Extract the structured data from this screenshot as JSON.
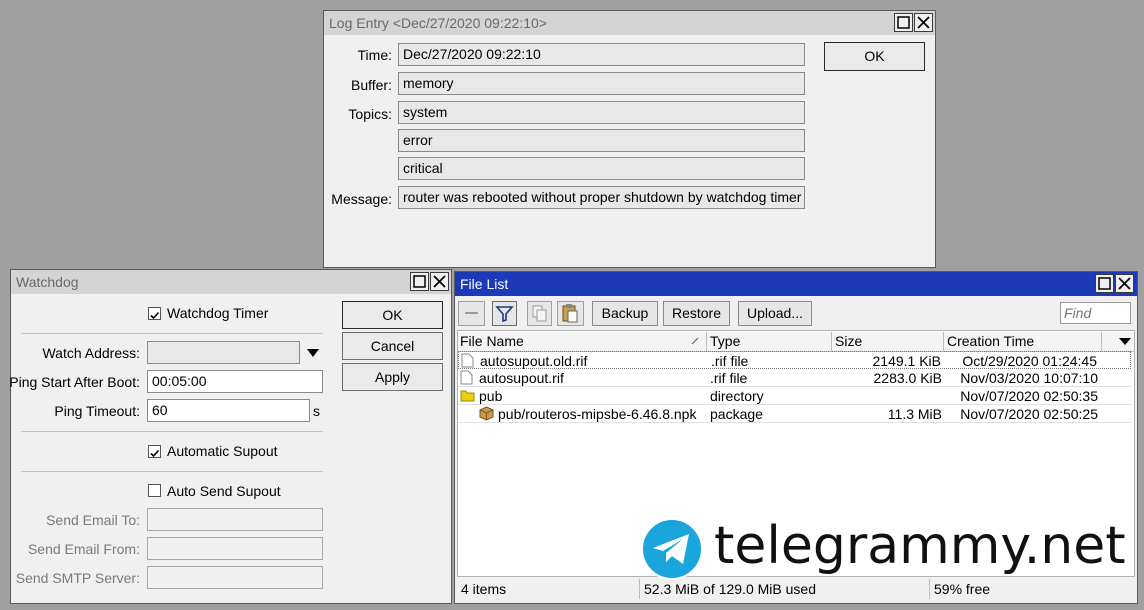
{
  "log_entry": {
    "title": "Log Entry <Dec/27/2020 09:22:10>",
    "labels": {
      "time": "Time:",
      "buffer": "Buffer:",
      "topics": "Topics:",
      "message": "Message:"
    },
    "time": "Dec/27/2020 09:22:10",
    "buffer": "memory",
    "topics": [
      "system",
      "error",
      "critical"
    ],
    "message": "router was rebooted without proper shutdown by watchdog timer",
    "ok_label": "OK"
  },
  "watchdog": {
    "title": "Watchdog",
    "watchdog_timer": {
      "label": "Watchdog Timer",
      "checked": true
    },
    "watch_address": {
      "label": "Watch Address:",
      "value": ""
    },
    "ping_start": {
      "label": "Ping Start After Boot:",
      "value": "00:05:00"
    },
    "ping_timeout": {
      "label": "Ping Timeout:",
      "value": "60",
      "unit": "s"
    },
    "automatic_supout": {
      "label": "Automatic Supout",
      "checked": true
    },
    "auto_send_supout": {
      "label": "Auto Send Supout",
      "checked": false
    },
    "send_email_to": {
      "label": "Send Email To:",
      "value": ""
    },
    "send_email_from": {
      "label": "Send Email From:",
      "value": ""
    },
    "send_smtp_server": {
      "label": "Send SMTP Server:",
      "value": ""
    },
    "buttons": {
      "ok": "OK",
      "cancel": "Cancel",
      "apply": "Apply"
    }
  },
  "file_list": {
    "title": "File List",
    "toolbar": {
      "backup": "Backup",
      "restore": "Restore",
      "upload": "Upload...",
      "find_placeholder": "Find"
    },
    "columns": [
      "File Name",
      "Type",
      "Size",
      "Creation Time"
    ],
    "rows": [
      {
        "name": "autosupout.old.rif",
        "type": ".rif file",
        "size": "2149.1 KiB",
        "created": "Oct/29/2020 01:24:45",
        "icon": "file-icon"
      },
      {
        "name": "autosupout.rif",
        "type": ".rif file",
        "size": "2283.0 KiB",
        "created": "Nov/03/2020 10:07:10",
        "icon": "file-icon"
      },
      {
        "name": "pub",
        "type": "directory",
        "size": "",
        "created": "Nov/07/2020 02:50:35",
        "icon": "folder-icon"
      },
      {
        "name": "pub/routeros-mipsbe-6.46.8.npk",
        "type": "package",
        "size": "11.3 MiB",
        "created": "Nov/07/2020 02:50:25",
        "icon": "package-icon"
      }
    ],
    "status": {
      "items": "4 items",
      "used": "52.3 MiB of 129.0 MiB used",
      "free": "59% free"
    }
  },
  "watermark": {
    "text": "telegrammy.net"
  },
  "colors": {
    "active_title": "#1c3ab8",
    "desktop": "#a0a0a0"
  }
}
